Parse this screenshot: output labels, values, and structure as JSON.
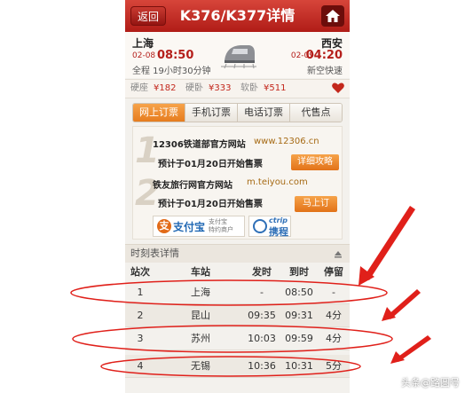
{
  "header": {
    "back_label": "返回",
    "title": "K376/K377详情",
    "home_icon": "home-icon"
  },
  "route": {
    "from_station": "上海",
    "from_date": "02-08",
    "from_time": "08:50",
    "to_station": "西安",
    "to_date": "02-09",
    "to_time": "04:20",
    "duration": "全程 19小时30分钟",
    "train_type": "新空快速"
  },
  "prices": [
    {
      "label": "硬座",
      "value": "¥182"
    },
    {
      "label": "硬卧",
      "value": "¥333"
    },
    {
      "label": "软卧",
      "value": "¥511"
    }
  ],
  "tabs": [
    {
      "label": "网上订票",
      "active": true
    },
    {
      "label": "手机订票",
      "active": false
    },
    {
      "label": "电话订票",
      "active": false
    },
    {
      "label": "代售点",
      "active": false
    }
  ],
  "booking": [
    {
      "num": "1",
      "site": "12306铁道部官方网站",
      "url": "www.12306.cn",
      "note": "预计于01月20日开始售票",
      "button": "详细攻略"
    },
    {
      "num": "2",
      "site": "铁友旅行网官方网站",
      "url": "m.teiyou.com",
      "note": "预计于01月20日开始售票",
      "button": "马上订"
    }
  ],
  "logos": {
    "alipay_mark": "支",
    "alipay_name": "支付宝",
    "alipay_sub1": "支付宝",
    "alipay_sub2": "特约商户",
    "ctrip_en": "ctrip",
    "ctrip_cn": "携程"
  },
  "timetable": {
    "title": "时刻表详情",
    "columns": [
      "站次",
      "车站",
      "发时",
      "到时",
      "停留"
    ],
    "rows": [
      [
        "1",
        "上海",
        "-",
        "08:50",
        "-"
      ],
      [
        "2",
        "昆山",
        "09:35",
        "09:31",
        "4分"
      ],
      [
        "3",
        "苏州",
        "10:03",
        "09:59",
        "4分"
      ],
      [
        "4",
        "无锡",
        "10:36",
        "10:31",
        "5分"
      ]
    ]
  },
  "watermark": "头条@路圆号",
  "colors": {
    "header_red": "#b01c17",
    "accent_orange": "#e67c1e",
    "price_red": "#c3281d",
    "annotation_red": "#e0201a"
  }
}
